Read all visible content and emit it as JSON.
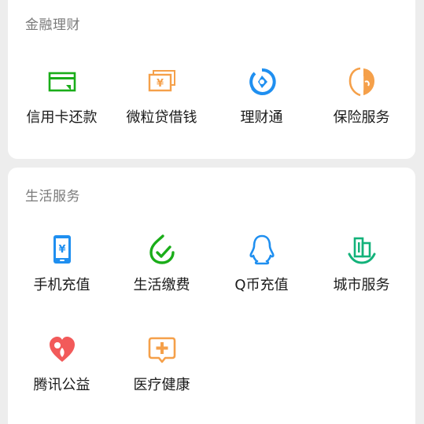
{
  "finance": {
    "title": "金融理财",
    "items": [
      {
        "label": "信用卡还款",
        "icon": "credit-card-icon"
      },
      {
        "label": "微粒贷借钱",
        "icon": "loan-yen-icon"
      },
      {
        "label": "理财通",
        "icon": "wealth-icon"
      },
      {
        "label": "保险服务",
        "icon": "insurance-icon"
      }
    ]
  },
  "life": {
    "title": "生活服务",
    "items": [
      {
        "label": "手机充值",
        "icon": "mobile-topup-icon"
      },
      {
        "label": "生活缴费",
        "icon": "utility-bill-icon"
      },
      {
        "label": "Q币充值",
        "icon": "qq-penguin-icon"
      },
      {
        "label": "城市服务",
        "icon": "city-service-icon"
      },
      {
        "label": "腾讯公益",
        "icon": "charity-heart-icon"
      },
      {
        "label": "医疗健康",
        "icon": "medical-icon"
      }
    ]
  },
  "colors": {
    "green": "#1aad19",
    "orange": "#f5a04a",
    "blue": "#1f8ff0",
    "red": "#f25a5a",
    "teal": "#13b27a"
  }
}
